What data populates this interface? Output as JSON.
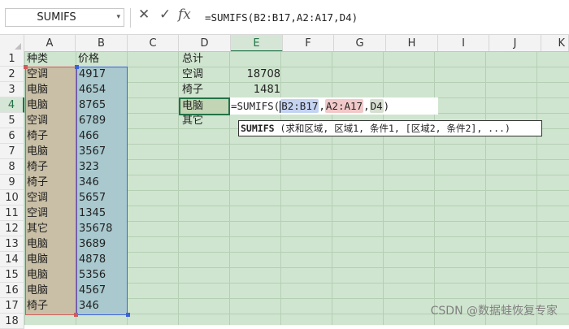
{
  "formula_bar": {
    "name_box": "SUMIFS",
    "cancel_icon": "✕",
    "confirm_icon": "✓",
    "fx_label": "fx",
    "formula": "=SUMIFS(B2:B17,A2:A17,D4)"
  },
  "columns": [
    "A",
    "B",
    "C",
    "D",
    "E",
    "F",
    "G",
    "H",
    "I",
    "J",
    "K"
  ],
  "selected_column": "E",
  "rows": [
    "1",
    "2",
    "3",
    "4",
    "5",
    "6",
    "7",
    "8",
    "9",
    "10",
    "11",
    "12",
    "13",
    "14",
    "15",
    "16",
    "17",
    "18"
  ],
  "selected_row": "4",
  "headers": {
    "A1": "种类",
    "B1": "价格"
  },
  "table": [
    {
      "kind": "空调",
      "price": "4917"
    },
    {
      "kind": "电脑",
      "price": "4654"
    },
    {
      "kind": "电脑",
      "price": "8765"
    },
    {
      "kind": "空调",
      "price": "6789"
    },
    {
      "kind": "椅子",
      "price": "466"
    },
    {
      "kind": "电脑",
      "price": "3567"
    },
    {
      "kind": "椅子",
      "price": "323"
    },
    {
      "kind": "椅子",
      "price": "346"
    },
    {
      "kind": "空调",
      "price": "5657"
    },
    {
      "kind": "空调",
      "price": "1345"
    },
    {
      "kind": "其它",
      "price": "35678"
    },
    {
      "kind": "电脑",
      "price": "3689"
    },
    {
      "kind": "电脑",
      "price": "4878"
    },
    {
      "kind": "电脑",
      "price": "5356"
    },
    {
      "kind": "电脑",
      "price": "4567"
    },
    {
      "kind": "椅子",
      "price": "346"
    }
  ],
  "summary": {
    "header": "总计",
    "rows": [
      {
        "label": "空调",
        "value": "18708"
      },
      {
        "label": "椅子",
        "value": "1481"
      },
      {
        "label": "电脑",
        "value": ""
      },
      {
        "label": "其它",
        "value": ""
      }
    ]
  },
  "editor": {
    "prefix": "=SUMIFS(",
    "arg1": "B2:B17",
    "sep1": ",",
    "arg2": "A2:A17",
    "sep2": ",",
    "arg3": "D4",
    "suffix": ")"
  },
  "tooltip": {
    "func": "SUMIFS",
    "args": " (求和区域, 区域1, 条件1, [区域2, 条件2], ...)"
  },
  "watermark": "CSDN @数据蛙恢复专家",
  "colors": {
    "grid_bg": "#cfe5cf",
    "range_a_border": "#d25a5a",
    "range_b_border": "#3d63d8",
    "active_border": "#217346"
  }
}
